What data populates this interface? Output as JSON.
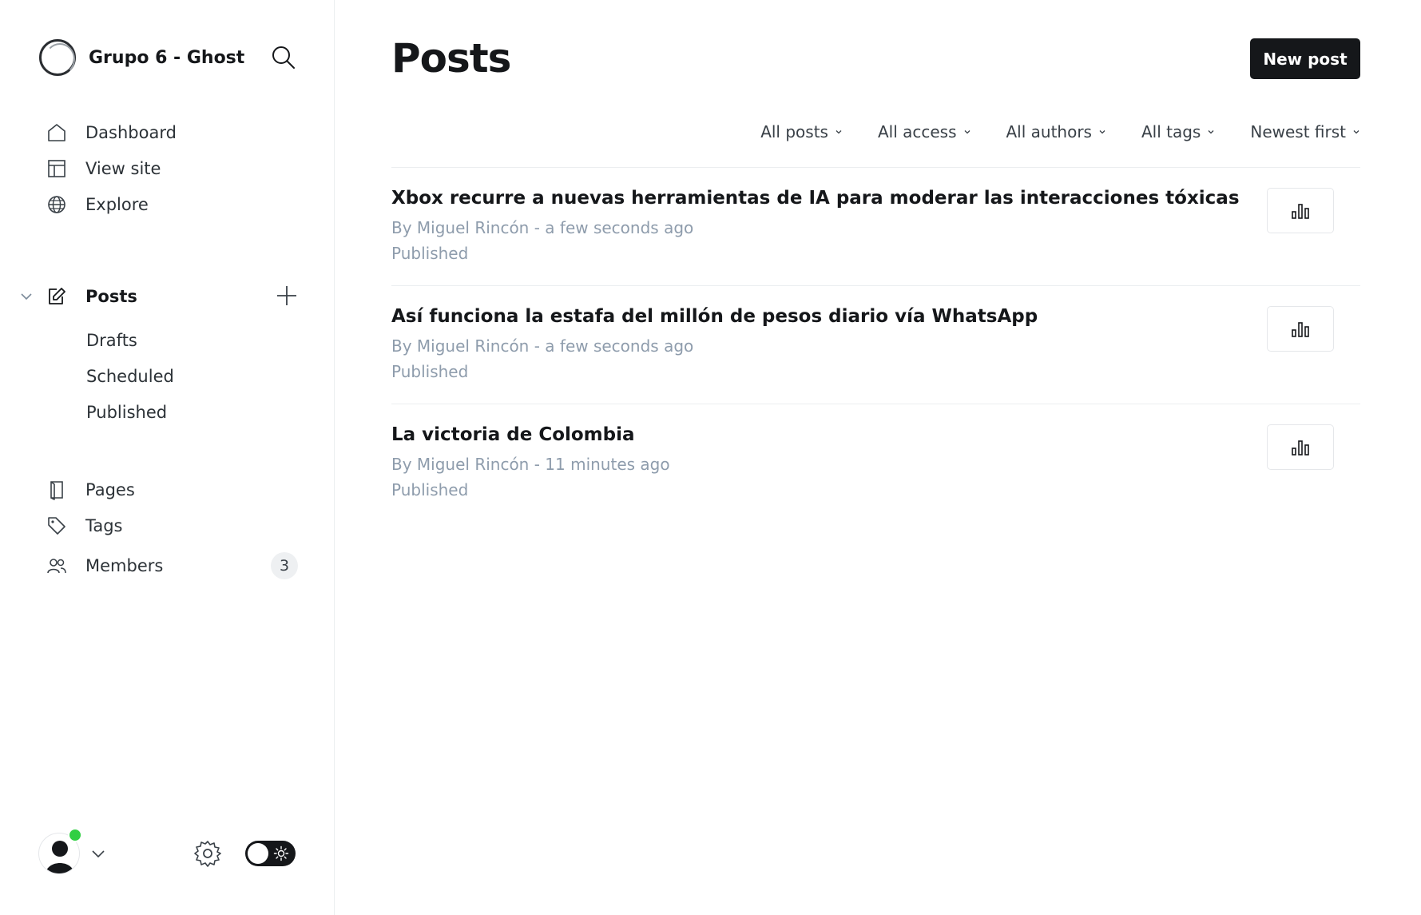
{
  "sidebar": {
    "site_title": "Grupo 6 - Ghost ...",
    "nav": [
      {
        "label": "Dashboard",
        "icon": "home-icon"
      },
      {
        "label": "View site",
        "icon": "layout-icon"
      },
      {
        "label": "Explore",
        "icon": "globe-icon"
      }
    ],
    "posts_label": "Posts",
    "posts_sub": [
      "Drafts",
      "Scheduled",
      "Published"
    ],
    "secondary": [
      {
        "label": "Pages",
        "icon": "page-icon"
      },
      {
        "label": "Tags",
        "icon": "tag-icon"
      },
      {
        "label": "Members",
        "icon": "members-icon",
        "count": "3"
      }
    ]
  },
  "main": {
    "title": "Posts",
    "new_post_label": "New post",
    "filters": [
      "All posts",
      "All access",
      "All authors",
      "All tags",
      "Newest first"
    ],
    "posts": [
      {
        "title": "Xbox recurre a nuevas herramientas de IA para moderar las interacciones tóxicas",
        "meta": "By Miguel Rincón - a few seconds ago",
        "status": "Published"
      },
      {
        "title": "Así funciona la estafa del millón de pesos diario vía WhatsApp",
        "meta": "By Miguel Rincón - a few seconds ago",
        "status": "Published"
      },
      {
        "title": "La victoria de Colombia",
        "meta": "By Miguel Rincón - 11 minutes ago",
        "status": "Published"
      }
    ]
  },
  "colors": {
    "accent": "#15171a",
    "online": "#30cf43",
    "muted": "#8e9cac"
  }
}
